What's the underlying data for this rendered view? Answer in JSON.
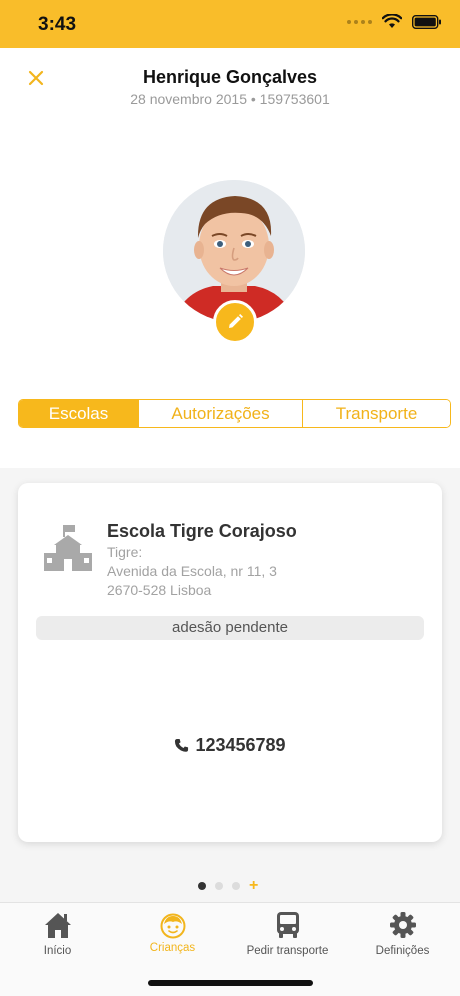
{
  "status_bar": {
    "time": "3:43"
  },
  "header": {
    "close_icon": "close-icon",
    "title": "Henrique Gonçalves",
    "subtitle": "28 novembro 2015 • 159753601"
  },
  "profile": {
    "edit_icon": "pencil-icon"
  },
  "tabs": [
    {
      "label": "Escolas",
      "active": true
    },
    {
      "label": "Autorizações",
      "active": false
    },
    {
      "label": "Transporte",
      "active": false
    }
  ],
  "school_card": {
    "icon": "school-icon",
    "name": "Escola Tigre Corajoso",
    "address_lines": [
      "Tigre:",
      "Avenida da Escola, nr 11, 3",
      "2670-528 Lisboa"
    ],
    "status": "adesão pendente",
    "phone_icon": "phone-icon",
    "phone": "123456789"
  },
  "pager": {
    "pages": 3,
    "current": 1,
    "add_symbol": "+"
  },
  "tabbar": {
    "items": [
      {
        "label": "Início",
        "icon": "home-icon",
        "active": false
      },
      {
        "label": "Crianças",
        "icon": "child-face-icon",
        "active": true
      },
      {
        "label": "Pedir transporte",
        "icon": "bus-icon",
        "active": false
      },
      {
        "label": "Definições",
        "icon": "gear-icon",
        "active": false
      }
    ]
  },
  "colors": {
    "accent": "#f7b81c",
    "status_bar": "#f9bd2a"
  }
}
